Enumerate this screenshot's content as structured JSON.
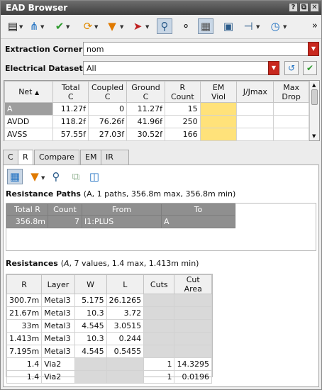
{
  "window": {
    "title": "EAD Browser",
    "help_label": "?",
    "restore_label": "⧉",
    "close_label": "✕"
  },
  "toolbar": {
    "icons": [
      "properties-icon",
      "schematic-icon",
      "check-icon",
      "refresh-icon",
      "filter-icon",
      "select-pointer-icon",
      "zoom-icon",
      "binoculars-icon",
      "panel-icon",
      "save-icon",
      "probe-icon",
      "meter-icon"
    ],
    "overflow_label": "»"
  },
  "extraction": {
    "label": "Extraction Corner:",
    "value": "nom"
  },
  "dataset": {
    "label": "Electrical Dataset:",
    "value": "All"
  },
  "nets": {
    "headers": [
      {
        "line1": "Net",
        "line2": ""
      },
      {
        "line1": "Total",
        "line2": "C"
      },
      {
        "line1": "Coupled",
        "line2": "C"
      },
      {
        "line1": "Ground",
        "line2": "C"
      },
      {
        "line1": "R",
        "line2": "Count"
      },
      {
        "line1": "EM",
        "line2": "Viol"
      },
      {
        "line1": "J/Jmax",
        "line2": ""
      },
      {
        "line1": "Max",
        "line2": "Drop"
      }
    ],
    "rows": [
      {
        "net": "A",
        "total_c": "11.27f",
        "coupled_c": "0",
        "ground_c": "11.27f",
        "r_count": "15",
        "em_viol": "",
        "jjmax": "",
        "max_drop": ""
      },
      {
        "net": "AVDD",
        "total_c": "118.2f",
        "coupled_c": "76.26f",
        "ground_c": "41.96f",
        "r_count": "250",
        "em_viol": "",
        "jjmax": "",
        "max_drop": ""
      },
      {
        "net": "AVSS",
        "total_c": "57.55f",
        "coupled_c": "27.03f",
        "ground_c": "30.52f",
        "r_count": "166",
        "em_viol": "",
        "jjmax": "",
        "max_drop": ""
      }
    ],
    "sort_indicator": "▲"
  },
  "tabs": [
    "C",
    "R",
    "Compare",
    "EM",
    "IR Drop"
  ],
  "active_tab": "R",
  "r_panel": {
    "tool_icons": [
      "highlight-icon",
      "filter-icon",
      "magnifier-icon",
      "copy-icon",
      "columns-icon"
    ],
    "paths_title": "Resistance Paths",
    "paths_summary": "(A, 1 paths, 356.8m max, 356.8m min)",
    "paths_headers": [
      "Total R",
      "Count",
      "From",
      "To"
    ],
    "paths_rows": [
      {
        "total_r": "356.8m",
        "count": "7",
        "from": "I1:PLUS",
        "to": "A"
      }
    ],
    "res_title": "Resistances",
    "res_summary_pre": "(",
    "res_summary_net": "A",
    "res_summary_post": ", 7 values, 1.4 max, 1.413m min)",
    "res_headers": [
      "R",
      "Layer",
      "W",
      "L",
      "Cuts",
      "Cut Area"
    ],
    "res_rows": [
      {
        "r": "300.7m",
        "layer": "Metal3",
        "w": "5.175",
        "l": "26.1265",
        "cuts": "",
        "cut_area": ""
      },
      {
        "r": "21.67m",
        "layer": "Metal3",
        "w": "10.3",
        "l": "3.72",
        "cuts": "",
        "cut_area": ""
      },
      {
        "r": "33m",
        "layer": "Metal3",
        "w": "4.545",
        "l": "3.0515",
        "cuts": "",
        "cut_area": ""
      },
      {
        "r": "1.413m",
        "layer": "Metal3",
        "w": "10.3",
        "l": "0.244",
        "cuts": "",
        "cut_area": ""
      },
      {
        "r": "7.195m",
        "layer": "Metal3",
        "w": "4.545",
        "l": "0.5455",
        "cuts": "",
        "cut_area": ""
      },
      {
        "r": "1.4",
        "layer": "Via2",
        "w": "",
        "l": "",
        "cuts": "1",
        "cut_area": "14.3295"
      },
      {
        "r": "1.4",
        "layer": "Via2",
        "w": "",
        "l": "",
        "cuts": "1",
        "cut_area": "0.0196"
      }
    ]
  },
  "colors": {
    "title_bar": "#4a4a4a",
    "em_viol_highlight": "#ffe27a",
    "combo_arrow": "#c8281e",
    "header_dark": "#8f8f8f"
  }
}
